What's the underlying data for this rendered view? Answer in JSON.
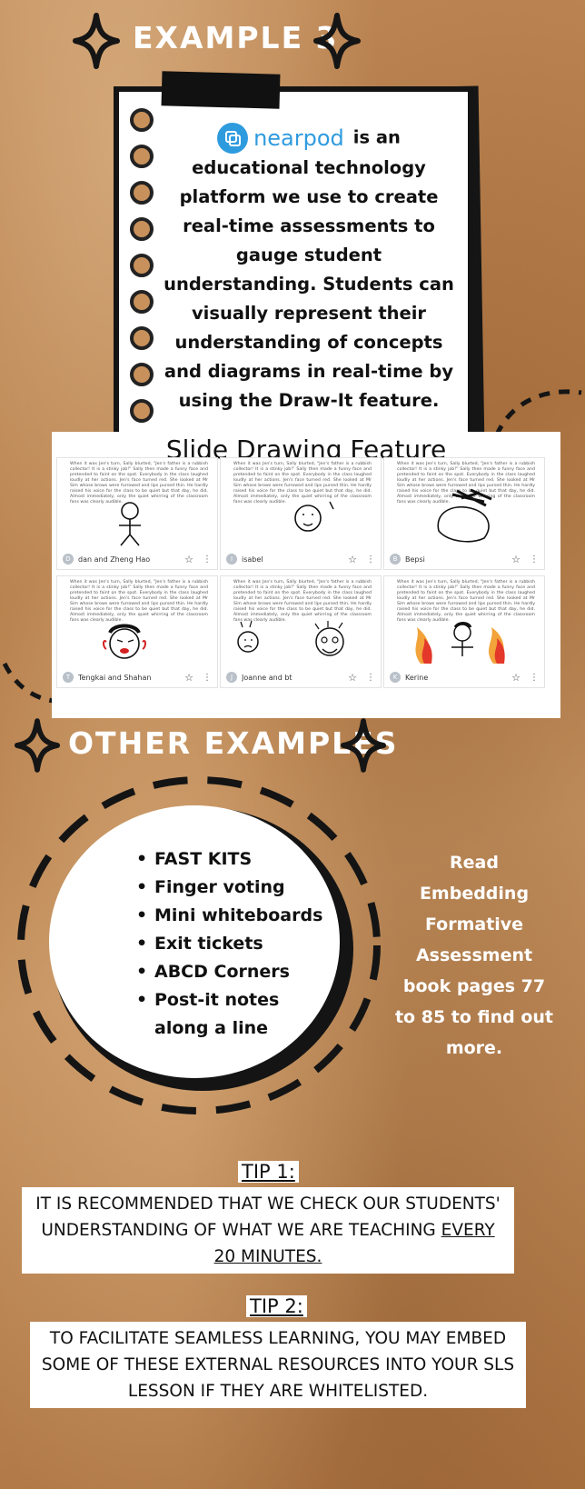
{
  "example": {
    "title": "EXAMPLE 3",
    "brand": "nearpod",
    "description": "is an educational technology platform we use to create real-time assessments to gauge student understanding. Students can visually represent their understanding of concepts and diagrams in real-time by using the Draw-It feature."
  },
  "slides": {
    "title": "Slide Drawing Feature",
    "passage": "When it was Jen's turn, Sally blurted, \"Jen's father is a rubbish collector! It is a stinky job!\" Sally then made a funny face and pretended to faint on the spot. Everybody in the class laughed loudly at her actions. Jen's face turned red. She looked at Mr Sim whose brows were furrowed and lips pursed thin. He hardly raised his voice for the class to be quiet but that day, he did. Almost immediately, only the quiet whirring of the classroom fans was clearly audible.",
    "responses": [
      {
        "initial": "D",
        "name": "dan and Zheng Hao"
      },
      {
        "initial": "I",
        "name": "isabel"
      },
      {
        "initial": "B",
        "name": "Bepsi"
      },
      {
        "initial": "T",
        "name": "Tengkai and Shahan"
      },
      {
        "initial": "J",
        "name": "Joanne and bt"
      },
      {
        "initial": "K",
        "name": "Kerine"
      }
    ]
  },
  "other": {
    "title": "OTHER EXAMPLES",
    "items": [
      "FAST KITS",
      "Finger voting",
      "Mini whiteboards",
      "Exit tickets",
      "ABCD Corners",
      "Post-it notes along a line"
    ],
    "read_more": "Read Embedding Formative Assessment book pages 77 to 85 to find out more."
  },
  "tips": {
    "tip1_label": "TIP 1:",
    "tip1_text_a": "IT IS RECOMMENDED THAT WE CHECK OUR STUDENTS' UNDERSTANDING OF WHAT WE ARE TEACHING ",
    "tip1_text_b": "EVERY 20 MINUTES.",
    "tip2_label": "TIP 2:",
    "tip2_text": "TO FACILITATE SEAMLESS LEARNING, YOU MAY EMBED SOME OF THESE EXTERNAL RESOURCES INTO YOUR SLS LESSON IF THEY ARE WHITELISTED."
  },
  "colors": {
    "background": "#b27945",
    "nearpod_blue": "#2f9bdf",
    "ink": "#111111"
  }
}
